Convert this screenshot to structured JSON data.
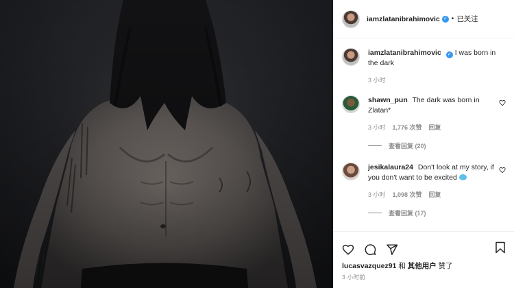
{
  "post": {
    "author": "iamzlatanibrahimovic",
    "follow_state": "已关注",
    "separator": "•"
  },
  "caption": {
    "username": "iamzlatanibrahimovic",
    "text": "I was born in the dark",
    "time": "3 小时"
  },
  "comments": [
    {
      "username": "shawn_pun",
      "text": "The dark was born in Zlatan*",
      "time": "3 小时",
      "likes": "1,776 次赞",
      "reply_label": "回复",
      "view_replies": "查看回复 (20)"
    },
    {
      "username": "jesikalaura24",
      "text": "Don't look at my story, if you don't want to be excited",
      "emoji": "blue-bubbles-emoji",
      "time": "3 小时",
      "likes": "1,098 次赞",
      "reply_label": "回复",
      "view_replies": "查看回复 (17)"
    }
  ],
  "actions": {
    "icons": [
      "heart-icon",
      "comment-icon",
      "share-icon",
      "bookmark-icon"
    ]
  },
  "likes_line": {
    "first_user": "lucasvazquez91",
    "connector": "和",
    "others": "其他用户",
    "suffix": "赞了"
  },
  "timestamp": "3 小时前",
  "colors": {
    "verified": "#3897f0",
    "muted": "#8e8e8e",
    "text": "#262626",
    "border": "#efefef",
    "photo_bg": "#25262a"
  }
}
